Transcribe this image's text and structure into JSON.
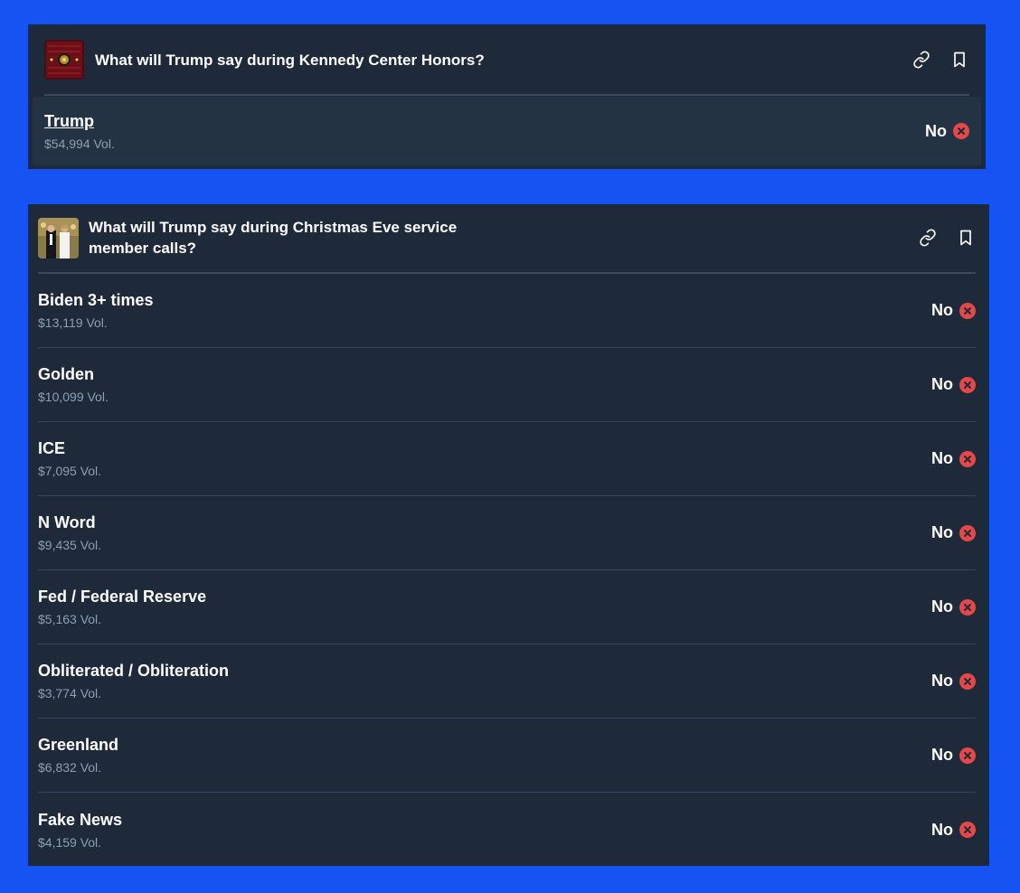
{
  "cards": [
    {
      "title": "What will Trump say during Kennedy Center Honors?",
      "thumbnail": "kennedy-center-thumbnail",
      "actions": [
        "link-icon",
        "bookmark-icon"
      ],
      "rows": [
        {
          "outcome": "Trump",
          "volume": "$54,994 Vol.",
          "result": "No"
        }
      ]
    },
    {
      "title": "What will Trump say during Christmas Eve service member calls?",
      "thumbnail": "trump-couple-thumbnail",
      "actions": [
        "link-icon",
        "bookmark-icon"
      ],
      "rows": [
        {
          "outcome": "Biden 3+ times",
          "volume": "$13,119 Vol.",
          "result": "No"
        },
        {
          "outcome": "Golden",
          "volume": "$10,099 Vol.",
          "result": "No"
        },
        {
          "outcome": "ICE",
          "volume": "$7,095 Vol.",
          "result": "No"
        },
        {
          "outcome": "N Word",
          "volume": "$9,435 Vol.",
          "result": "No"
        },
        {
          "outcome": "Fed / Federal Reserve",
          "volume": "$5,163 Vol.",
          "result": "No"
        },
        {
          "outcome": "Obliterated / Obliteration",
          "volume": "$3,774 Vol.",
          "result": "No"
        },
        {
          "outcome": "Greenland",
          "volume": "$6,832 Vol.",
          "result": "No"
        },
        {
          "outcome": "Fake News",
          "volume": "$4,159 Vol.",
          "result": "No"
        }
      ]
    }
  ],
  "colors": {
    "page_background": "#1553f2",
    "card_background": "#1e2a3a",
    "resolved_no": "#e54848"
  }
}
